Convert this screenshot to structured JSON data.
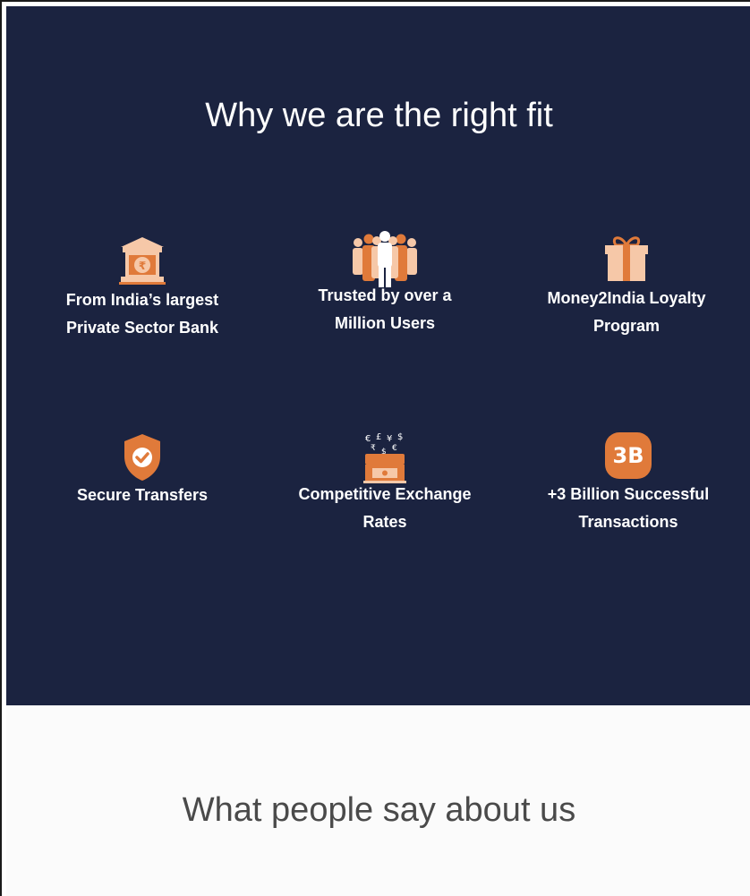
{
  "fit_section": {
    "title": "Why we are the right fit",
    "features": [
      {
        "icon": "bank-rupee-icon",
        "line1": "From India’s largest",
        "line2": "Private Sector Bank"
      },
      {
        "icon": "users-crowd-icon",
        "line1": "Trusted by over a",
        "line2": "Million Users"
      },
      {
        "icon": "gift-icon",
        "line1": "Money2India Loyalty",
        "line2": "Program"
      },
      {
        "icon": "shield-check-icon",
        "line1": "Secure Transfers",
        "line2": ""
      },
      {
        "icon": "exchange-rates-icon",
        "line1": "Competitive Exchange",
        "line2": "Rates"
      },
      {
        "icon": "three-billion-badge-icon",
        "badge_text": "3B",
        "line1": "+3 Billion Successful",
        "line2": "Transactions"
      }
    ]
  },
  "testimonials_section": {
    "title": "What people say about us"
  },
  "colors": {
    "navy": "#1b2340",
    "accent_orange": "#e07a3a",
    "light_peach": "#f6c8a8",
    "white": "#ffffff"
  }
}
